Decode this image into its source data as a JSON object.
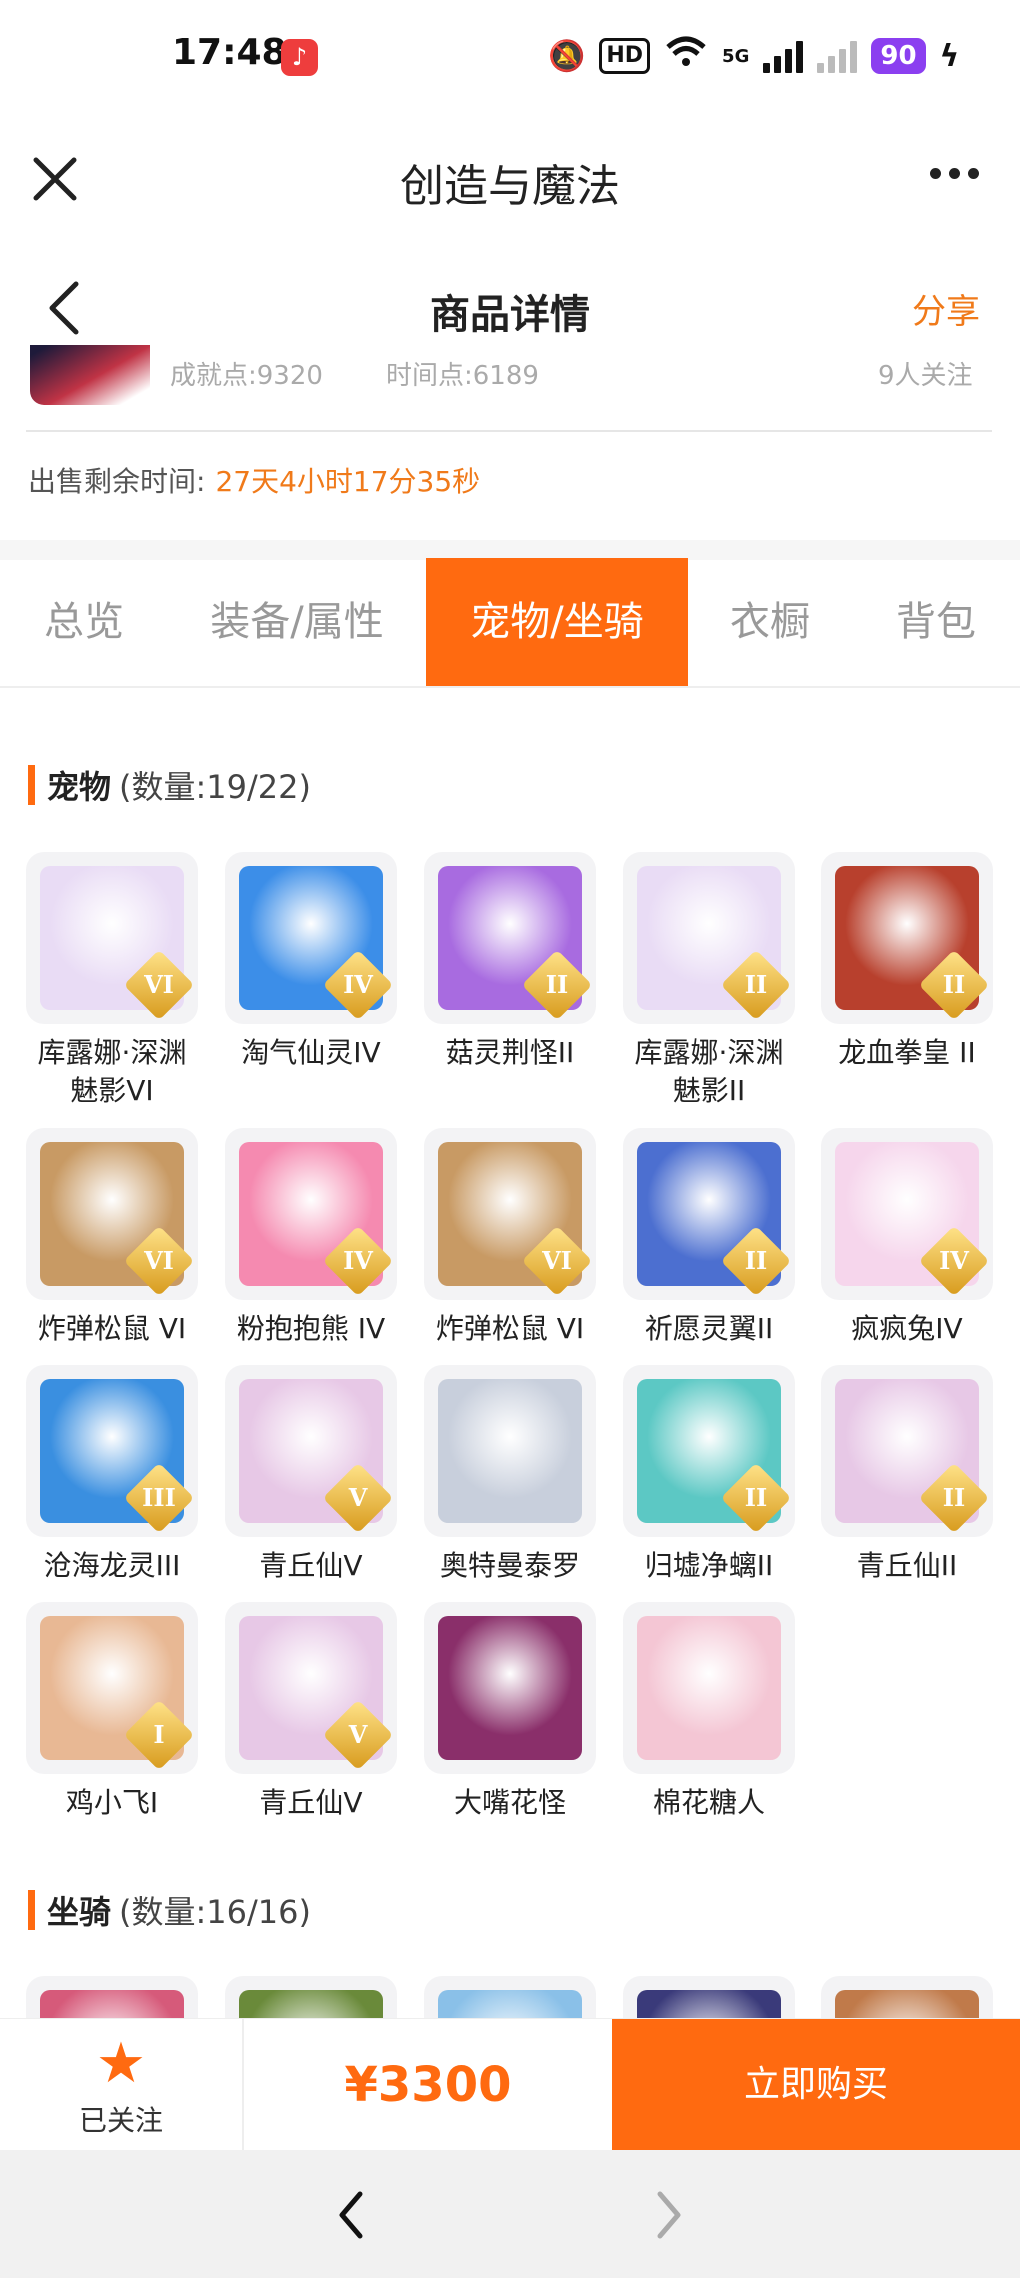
{
  "status_bar": {
    "time": "17:48",
    "hd_label": "HD",
    "signal_label": "5G",
    "battery": "90"
  },
  "app_bar": {
    "title": "创造与魔法"
  },
  "nav": {
    "title": "商品详情",
    "share": "分享"
  },
  "seller": {
    "achievement": "成就点:9320",
    "time_points": "时间点:6189",
    "followers": "9人关注"
  },
  "sale": {
    "remaining_label": "出售剩余时间:",
    "remaining_value": "27天4小时17分35秒"
  },
  "tabs": [
    "总览",
    "装备/属性",
    "宠物/坐骑",
    "衣橱",
    "背包"
  ],
  "active_tab": "宠物/坐骑",
  "pets_section": {
    "title": "宠物",
    "count": "(数量:19/22)"
  },
  "pets": [
    {
      "name": "库露娜·深渊魅影VI",
      "grade": "VI",
      "color": "#e9dcf5"
    },
    {
      "name": "淘气仙灵IV",
      "grade": "IV",
      "color": "#3c8ee8"
    },
    {
      "name": "菇灵荆怪II",
      "grade": "II",
      "color": "#a86be0"
    },
    {
      "name": "库露娜·深渊魅影II",
      "grade": "II",
      "color": "#e9dcf5"
    },
    {
      "name": "龙血拳皇 II",
      "grade": "II",
      "color": "#b8402d"
    },
    {
      "name": "炸弹松鼠 VI",
      "grade": "VI",
      "color": "#c89a64"
    },
    {
      "name": "粉抱抱熊 IV",
      "grade": "IV",
      "color": "#f58ab0"
    },
    {
      "name": "炸弹松鼠 VI",
      "grade": "VI",
      "color": "#c89a64"
    },
    {
      "name": "祈愿灵翼II",
      "grade": "II",
      "color": "#4c6fd0"
    },
    {
      "name": "疯疯兔IV",
      "grade": "IV",
      "color": "#f6d6ec"
    },
    {
      "name": "沧海龙灵III",
      "grade": "III",
      "color": "#3a8fe0"
    },
    {
      "name": "青丘仙V",
      "grade": "V",
      "color": "#e7c8e6"
    },
    {
      "name": "奥特曼泰罗",
      "grade": "",
      "color": "#c8cfdc"
    },
    {
      "name": "归墟净螭II",
      "grade": "II",
      "color": "#5cc8c4"
    },
    {
      "name": "青丘仙II",
      "grade": "II",
      "color": "#e7c8e6"
    },
    {
      "name": "鸡小飞I",
      "grade": "I",
      "color": "#e8b894"
    },
    {
      "name": "青丘仙V",
      "grade": "V",
      "color": "#e7c8e6"
    },
    {
      "name": "大嘴花怪",
      "grade": "",
      "color": "#8a2f6a"
    },
    {
      "name": "棉花糖人",
      "grade": "",
      "color": "#f4c6d4"
    }
  ],
  "mounts_section": {
    "title": "坐骑",
    "count": "(数量:16/16)"
  },
  "mount_colors": [
    "#d65a7a",
    "#6a8a3a",
    "#8ac0e8",
    "#3a3a7a",
    "#c07a4a"
  ],
  "bottom_bar": {
    "follow_label": "已关注",
    "price": "¥3300",
    "buy_label": "立即购买"
  },
  "colors": {
    "accent": "#ff6a10",
    "orange_text": "#f07a1a"
  }
}
